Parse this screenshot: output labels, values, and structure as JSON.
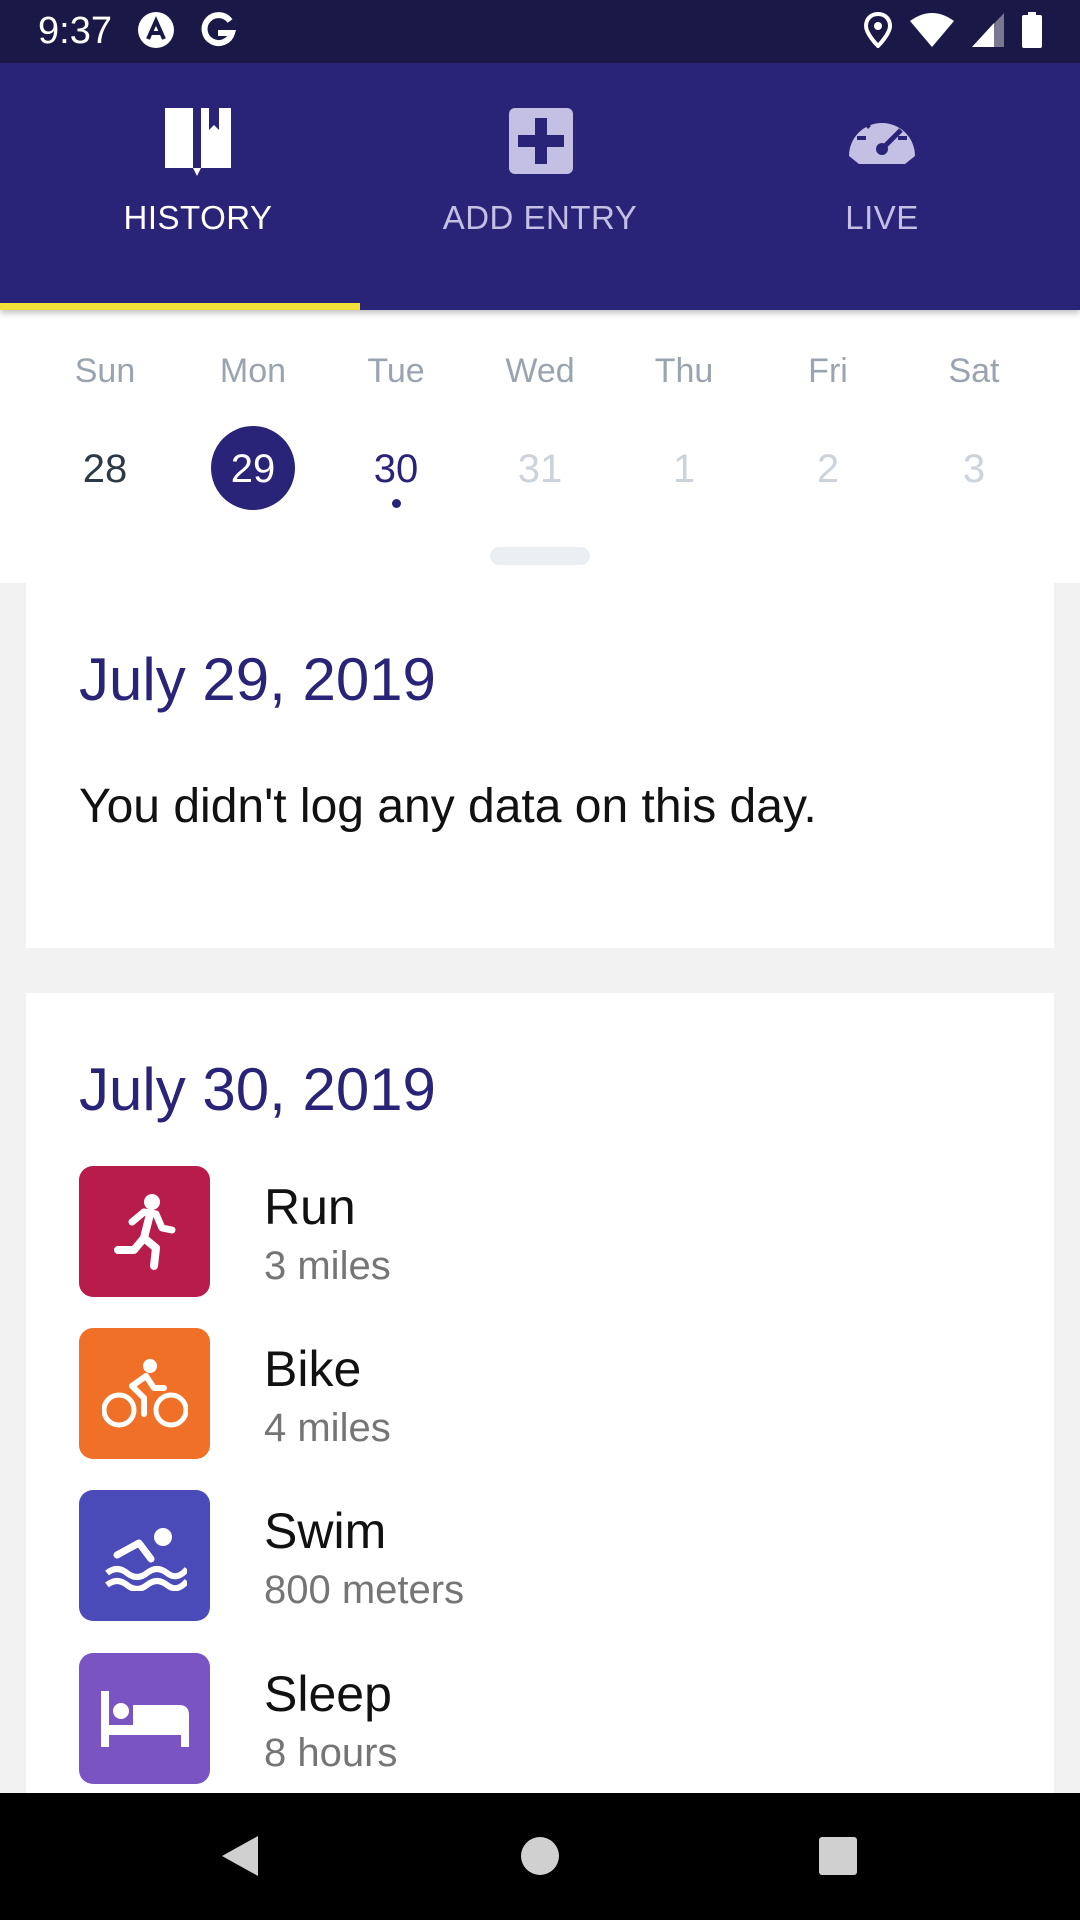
{
  "status_bar": {
    "time": "9:37",
    "icons": [
      "app-a-icon",
      "google-icon",
      "location-icon",
      "wifi-icon",
      "signal-icon",
      "battery-icon"
    ]
  },
  "tabs": [
    {
      "label": "HISTORY",
      "icon": "book-icon",
      "active": true
    },
    {
      "label": "ADD ENTRY",
      "icon": "plus-box-icon",
      "active": false
    },
    {
      "label": "LIVE",
      "icon": "speedometer-icon",
      "active": false
    }
  ],
  "week": {
    "day_names": [
      "Sun",
      "Mon",
      "Tue",
      "Wed",
      "Thu",
      "Fri",
      "Sat"
    ],
    "day_numbers": [
      "28",
      "29",
      "30",
      "31",
      "1",
      "2",
      "3"
    ],
    "selected": "29",
    "today": "30"
  },
  "entries": [
    {
      "date": "July 29, 2019",
      "message": "You didn't log any data on this day."
    },
    {
      "date": "July 30, 2019",
      "activities": [
        {
          "name": "Run",
          "value": "3 miles",
          "color": "#b71c4a",
          "icon": "running-icon"
        },
        {
          "name": "Bike",
          "value": "4 miles",
          "color": "#f07028",
          "icon": "bike-icon"
        },
        {
          "name": "Swim",
          "value": "800 meters",
          "color": "#4a4ab8",
          "icon": "swimming-icon"
        },
        {
          "name": "Sleep",
          "value": "8 hours",
          "color": "#7b54c4",
          "icon": "bed-icon"
        }
      ]
    }
  ],
  "colors": {
    "header": "#2a2478",
    "status_bar": "#1a1846",
    "indicator": "#f2e13a"
  },
  "nav": [
    "back-icon",
    "home-icon",
    "recents-icon"
  ]
}
